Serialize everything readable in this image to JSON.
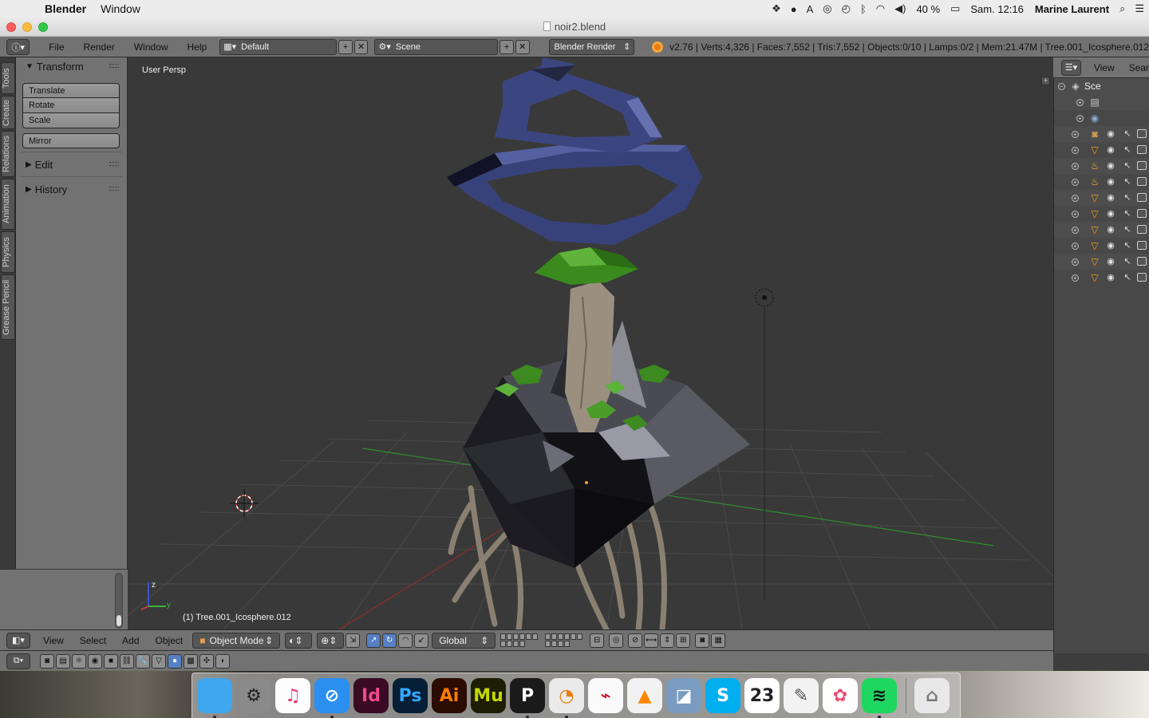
{
  "menubar": {
    "app_name": "Blender",
    "items": [
      "Window"
    ],
    "battery": "40 %",
    "datetime": "Sam. 12:16",
    "user": "Marine Laurent"
  },
  "window": {
    "title": "noir2.blend"
  },
  "info_header": {
    "menus": [
      "File",
      "Render",
      "Window",
      "Help"
    ],
    "layout": "Default",
    "scene": "Scene",
    "engine": "Blender Render",
    "stats": "v2.76 | Verts:4,326 | Faces:7,552 | Tris:7,552 | Objects:0/10 | Lamps:0/2 | Mem:21.47M | Tree.001_Icosphere.012"
  },
  "tabs": [
    "Tools",
    "Create",
    "Relations",
    "Animation",
    "Physics",
    "Grease Pencil"
  ],
  "toolshelf": {
    "transform_title": "Transform",
    "translate": "Translate",
    "rotate": "Rotate",
    "scale": "Scale",
    "mirror": "Mirror",
    "edit": "Edit",
    "history": "History"
  },
  "viewport": {
    "view_label": "User Persp",
    "object_label": "(1) Tree.001_Icosphere.012",
    "axis_z": "z",
    "axis_y": "y"
  },
  "outliner": {
    "view": "View",
    "search": "Sear",
    "scene_label": "Sce",
    "rows": [
      {
        "icon": "renderlayers-icon",
        "glyph": "▤"
      },
      {
        "icon": "world-icon",
        "glyph": "◉"
      },
      {
        "icon": "camera-icon",
        "glyph": "◙"
      },
      {
        "icon": "mesh-icon",
        "glyph": "▽"
      },
      {
        "icon": "lamp-icon",
        "glyph": "♨"
      },
      {
        "icon": "lamp-icon",
        "glyph": "♨"
      },
      {
        "icon": "mesh-icon",
        "glyph": "▽"
      },
      {
        "icon": "mesh-icon",
        "glyph": "▽"
      },
      {
        "icon": "mesh-icon",
        "glyph": "▽"
      },
      {
        "icon": "mesh-icon",
        "glyph": "▽"
      },
      {
        "icon": "mesh-icon",
        "glyph": "▽"
      },
      {
        "icon": "mesh-icon",
        "glyph": "▽"
      }
    ]
  },
  "view3d_header": {
    "menus": [
      "View",
      "Select",
      "Add",
      "Object"
    ],
    "mode": "Object Mode",
    "orientation": "Global"
  },
  "dock": [
    {
      "name": "finder-icon",
      "label": "",
      "bg": "#3fa7f0",
      "fg": "#fff"
    },
    {
      "name": "system-preferences-icon",
      "label": "⚙",
      "bg": "#8a8a8a",
      "fg": "#222"
    },
    {
      "name": "itunes-icon",
      "label": "♫",
      "bg": "#fdfdfd",
      "fg": "#e6396d"
    },
    {
      "name": "safari-icon",
      "label": "⊘",
      "bg": "#2b8ff0",
      "fg": "#fff"
    },
    {
      "name": "indesign-icon",
      "label": "Id",
      "bg": "#3a0b23",
      "fg": "#f0498b"
    },
    {
      "name": "photoshop-icon",
      "label": "Ps",
      "bg": "#061e36",
      "fg": "#30a8ff"
    },
    {
      "name": "illustrator-icon",
      "label": "Ai",
      "bg": "#2a0c00",
      "fg": "#ff7c00"
    },
    {
      "name": "muse-icon",
      "label": "Mu",
      "bg": "#1c1e05",
      "fg": "#c5d900"
    },
    {
      "name": "p-app-icon",
      "label": "P",
      "bg": "#1a1a1a",
      "fg": "#fff"
    },
    {
      "name": "blender-icon",
      "label": "◔",
      "bg": "#eaeaea",
      "fg": "#e87d0d"
    },
    {
      "name": "acrobat-icon",
      "label": "⌁",
      "bg": "#fafafa",
      "fg": "#d0021b"
    },
    {
      "name": "vlc-icon",
      "label": "▲",
      "bg": "#f2f2f2",
      "fg": "#ff8800"
    },
    {
      "name": "preview-icon",
      "label": "◪",
      "bg": "#7a9cc0",
      "fg": "#fff"
    },
    {
      "name": "skype-icon",
      "label": "S",
      "bg": "#00aff0",
      "fg": "#fff"
    },
    {
      "name": "calendar-icon",
      "label": "23",
      "bg": "#ffffff",
      "fg": "#222"
    },
    {
      "name": "textedit-icon",
      "label": "✎",
      "bg": "#f2f2f2",
      "fg": "#555"
    },
    {
      "name": "photos-icon",
      "label": "✿",
      "bg": "#ffffff",
      "fg": "#e94e77"
    },
    {
      "name": "spotify-icon",
      "label": "≋",
      "bg": "#1ed760",
      "fg": "#111"
    }
  ],
  "trash": {
    "name": "trash-icon",
    "label": "🗑"
  }
}
